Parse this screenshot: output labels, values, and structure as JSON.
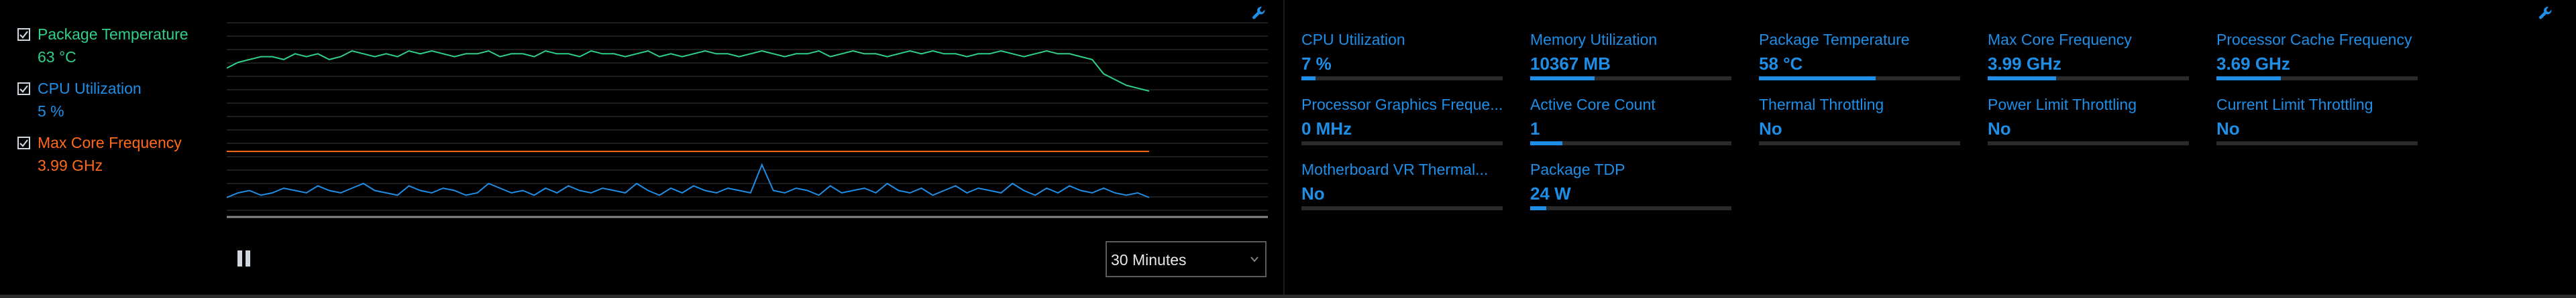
{
  "legend": [
    {
      "name": "Package Temperature",
      "value": "63 °C",
      "color": "#2fd18a",
      "checked": true
    },
    {
      "name": "CPU Utilization",
      "value": "5 %",
      "color": "#1e8ee6",
      "checked": true
    },
    {
      "name": "Max Core Frequency",
      "value": "3.99 GHz",
      "color": "#ff6a1a",
      "checked": true
    }
  ],
  "chart_data": {
    "type": "line",
    "title": "",
    "xlabel": "",
    "ylabel": "",
    "grid": true,
    "series": [
      {
        "name": "Package Temperature",
        "color": "#2fd18a",
        "values": [
          58,
          60,
          61,
          62,
          62,
          61,
          63,
          62,
          63,
          61,
          62,
          64,
          63,
          62,
          63,
          62,
          64,
          63,
          64,
          63,
          62,
          63,
          63,
          64,
          62,
          63,
          63,
          62,
          64,
          63,
          63,
          62,
          64,
          63,
          63,
          62,
          63,
          64,
          62,
          63,
          62,
          63,
          64,
          63,
          63,
          62,
          63,
          64,
          63,
          62,
          63,
          63,
          64,
          62,
          63,
          64,
          63,
          63,
          62,
          63,
          64,
          63,
          64,
          63,
          63,
          62,
          63,
          63,
          64,
          63,
          62,
          63,
          64,
          63,
          63,
          62,
          61,
          56,
          54,
          52,
          51,
          50
        ]
      },
      {
        "name": "Max Core Frequency",
        "color": "#ff6a1a",
        "values": [
          3.99,
          3.99,
          3.99,
          3.99,
          3.99,
          3.99,
          3.99,
          3.99,
          3.99,
          3.99,
          3.99,
          3.99,
          3.99,
          3.99,
          3.99,
          3.99,
          3.99,
          3.99,
          3.99,
          3.99,
          3.99,
          3.99,
          3.99,
          3.99,
          3.99,
          3.99,
          3.99,
          3.99,
          3.99,
          3.99,
          3.99,
          3.99,
          3.99,
          3.99,
          3.99,
          3.99,
          3.99,
          3.99,
          3.99,
          3.99,
          3.99,
          3.99,
          3.99,
          3.99,
          3.99,
          3.99,
          3.99,
          3.99,
          3.99,
          3.99,
          3.99,
          3.99,
          3.99,
          3.99,
          3.99,
          3.99,
          3.99,
          3.99,
          3.99,
          3.99,
          3.99,
          3.99,
          3.99,
          3.99,
          3.99,
          3.99,
          3.99,
          3.99,
          3.99,
          3.99,
          3.99,
          3.99,
          3.99,
          3.99,
          3.99,
          3.99,
          3.99,
          3.99,
          3.99,
          3.99,
          3.99,
          3.99
        ]
      },
      {
        "name": "CPU Utilization",
        "color": "#1e8ee6",
        "values": [
          6,
          8,
          9,
          7,
          8,
          10,
          9,
          8,
          11,
          9,
          8,
          10,
          12,
          9,
          8,
          7,
          11,
          9,
          8,
          10,
          9,
          7,
          8,
          12,
          10,
          8,
          9,
          7,
          10,
          8,
          11,
          9,
          8,
          10,
          9,
          8,
          12,
          9,
          7,
          10,
          8,
          11,
          9,
          8,
          10,
          9,
          8,
          20,
          9,
          8,
          10,
          9,
          7,
          11,
          8,
          9,
          10,
          8,
          12,
          9,
          8,
          10,
          7,
          9,
          11,
          8,
          10,
          9,
          8,
          12,
          9,
          7,
          10,
          8,
          11,
          9,
          8,
          10,
          8,
          7,
          8,
          6
        ]
      }
    ]
  },
  "controls": {
    "duration": "30 Minutes"
  },
  "metrics": [
    {
      "label": "CPU Utilization",
      "value": "7 %",
      "fill": 0.07
    },
    {
      "label": "Memory Utilization",
      "value": "10367  MB",
      "fill": 0.32
    },
    {
      "label": "Package Temperature",
      "value": "58 °C",
      "fill": 0.58
    },
    {
      "label": "Max Core Frequency",
      "value": "3.99 GHz",
      "fill": 0.34
    },
    {
      "label": "Processor Cache Frequency",
      "value": "3.69 GHz",
      "fill": 0.32
    },
    {
      "label": "Processor Graphics Freque...",
      "value": "0 MHz",
      "fill": 0
    },
    {
      "label": "Active Core Count",
      "value": "1",
      "fill": 0.16
    },
    {
      "label": "Thermal Throttling",
      "value": "No",
      "fill": 0
    },
    {
      "label": "Power Limit Throttling",
      "value": "No",
      "fill": 0
    },
    {
      "label": "Current Limit Throttling",
      "value": "No",
      "fill": 0
    },
    {
      "label": "Motherboard VR Thermal...",
      "value": "No",
      "fill": 0
    },
    {
      "label": "Package TDP",
      "value": "24 W",
      "fill": 0.08
    }
  ],
  "icons": {
    "graph_settings": "wrench-icon",
    "metrics_settings": "wrench-icon",
    "pause": "pause-icon",
    "dropdown": "chevron-down-icon"
  }
}
